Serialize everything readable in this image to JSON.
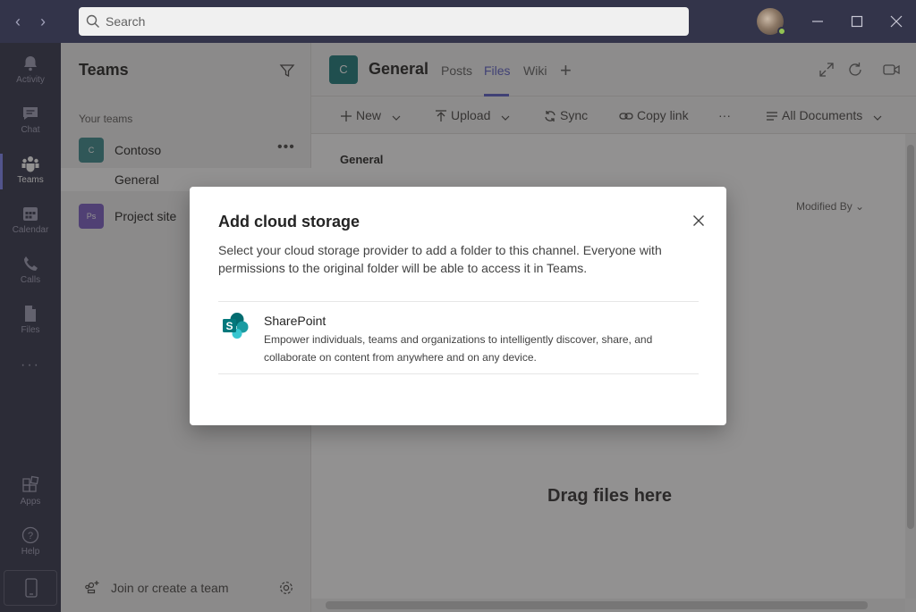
{
  "search": {
    "placeholder": "Search"
  },
  "rail": {
    "items": [
      {
        "label": "Activity",
        "icon": "bell-icon"
      },
      {
        "label": "Chat",
        "icon": "chat-icon"
      },
      {
        "label": "Teams",
        "icon": "teams-icon",
        "active": true
      },
      {
        "label": "Calendar",
        "icon": "calendar-icon"
      },
      {
        "label": "Calls",
        "icon": "phone-icon"
      },
      {
        "label": "Files",
        "icon": "file-icon"
      }
    ],
    "more": "···",
    "apps_label": "Apps",
    "help_label": "Help"
  },
  "teams_panel": {
    "title": "Teams",
    "section_label": "Your teams",
    "teams": [
      {
        "initials": "C",
        "name": "Contoso",
        "color": "#3a8a8c"
      },
      {
        "initials": "Ps",
        "name": "Project site",
        "color": "#7b5cc4"
      }
    ],
    "active_channel": "General",
    "join_label": "Join or create a team"
  },
  "channel": {
    "avatar": "C",
    "title": "General",
    "tabs": [
      {
        "label": "Posts"
      },
      {
        "label": "Files",
        "active": true
      },
      {
        "label": "Wiki"
      }
    ],
    "add_tab": "+"
  },
  "toolbar": {
    "new": "New",
    "upload": "Upload",
    "sync": "Sync",
    "copy_link": "Copy link",
    "more": "···",
    "view": "All Documents"
  },
  "files": {
    "breadcrumb": "General",
    "column_modified_by": "Modified By",
    "drag_text": "Drag files here"
  },
  "dialog": {
    "title": "Add cloud storage",
    "description": "Select your cloud storage provider to add a folder to this channel. Everyone with permissions to the original folder will be able to access it in Teams.",
    "providers": [
      {
        "name": "SharePoint",
        "description": "Empower individuals, teams and organizations to intelligently discover, share, and collaborate on content from anywhere and on any device.",
        "icon": "sharepoint-icon"
      }
    ]
  },
  "colors": {
    "rail": "#33344a",
    "accent": "#5b5fc7",
    "sharepoint": "#038387"
  }
}
